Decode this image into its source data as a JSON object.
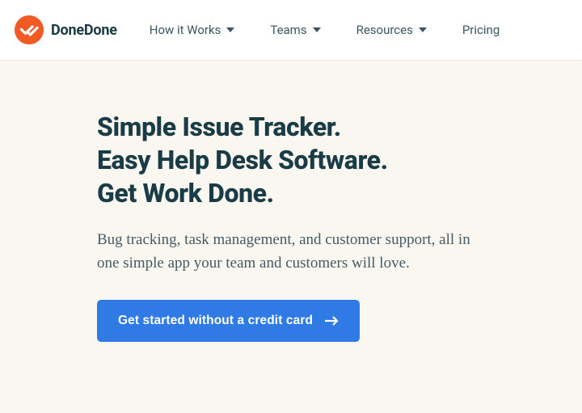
{
  "brand": {
    "name": "DoneDone"
  },
  "nav": {
    "items": [
      {
        "label": "How it Works",
        "hasDropdown": true
      },
      {
        "label": "Teams",
        "hasDropdown": true
      },
      {
        "label": "Resources",
        "hasDropdown": true
      },
      {
        "label": "Pricing",
        "hasDropdown": false
      }
    ]
  },
  "hero": {
    "headline_lines": [
      "Simple Issue Tracker.",
      "Easy Help Desk Software.",
      "Get Work Done."
    ],
    "subtext": "Bug tracking, task management, and customer support, all in one simple app your team and customers will love.",
    "cta_label": "Get started without a credit card"
  },
  "colors": {
    "brand_orange": "#f15a24",
    "cta_blue": "#2f7ae5",
    "dark_text": "#193c47",
    "hero_bg": "#faf7f1"
  }
}
